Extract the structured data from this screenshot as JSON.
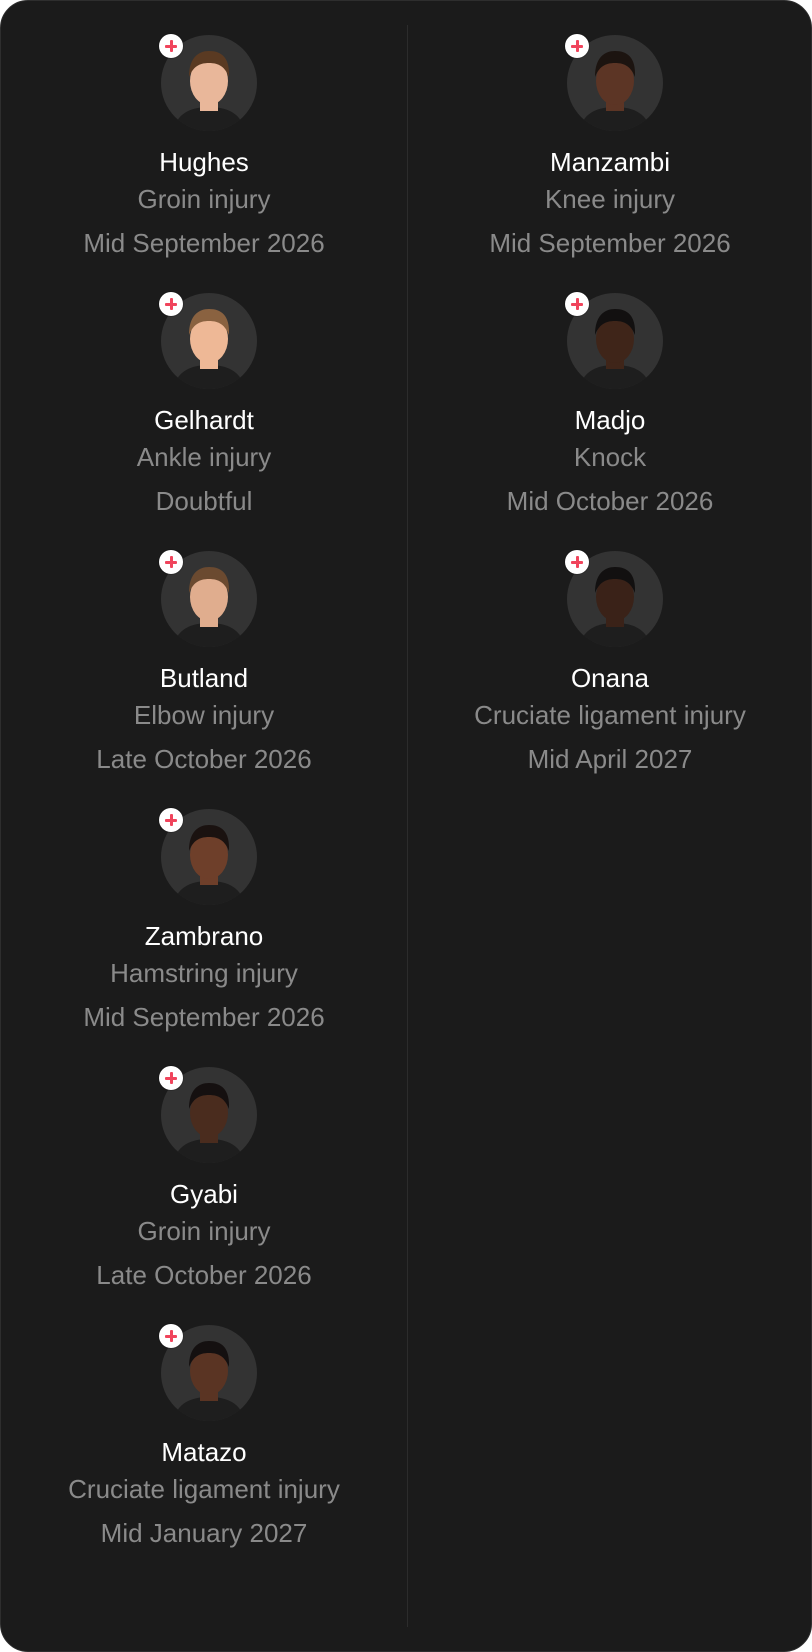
{
  "colors": {
    "background": "#1b1b1b",
    "name_text": "#ffffff",
    "secondary_text": "#8a8a8a",
    "injury_badge": "#f0445c"
  },
  "left_column": [
    {
      "name": "Hughes",
      "injury": "Groin injury",
      "return": "Mid September 2026",
      "skin": "#e9b79a",
      "hair": "#5a3a22"
    },
    {
      "name": "Gelhardt",
      "injury": "Ankle injury",
      "return": "Doubtful",
      "skin": "#eeb896",
      "hair": "#8a6240"
    },
    {
      "name": "Butland",
      "injury": "Elbow injury",
      "return": "Late October 2026",
      "skin": "#e0ad8e",
      "hair": "#6b4a30"
    },
    {
      "name": "Zambrano",
      "injury": "Hamstring injury",
      "return": "Mid September 2026",
      "skin": "#6e3f2a",
      "hair": "#1a1210"
    },
    {
      "name": "Gyabi",
      "injury": "Groin injury",
      "return": "Late October 2026",
      "skin": "#4a2c1e",
      "hair": "#151010"
    },
    {
      "name": "Matazo",
      "injury": "Cruciate ligament injury",
      "return": "Mid January 2027",
      "skin": "#5a3423",
      "hair": "#141010"
    }
  ],
  "right_column": [
    {
      "name": "Manzambi",
      "injury": "Knee injury",
      "return": "Mid September 2026",
      "skin": "#5c3525",
      "hair": "#1c1410"
    },
    {
      "name": "Madjo",
      "injury": "Knock",
      "return": "Mid October 2026",
      "skin": "#3f2519",
      "hair": "#121010"
    },
    {
      "name": "Onana",
      "injury": "Cruciate ligament injury",
      "return": "Mid April 2027",
      "skin": "#3a2218",
      "hair": "#121010"
    }
  ]
}
